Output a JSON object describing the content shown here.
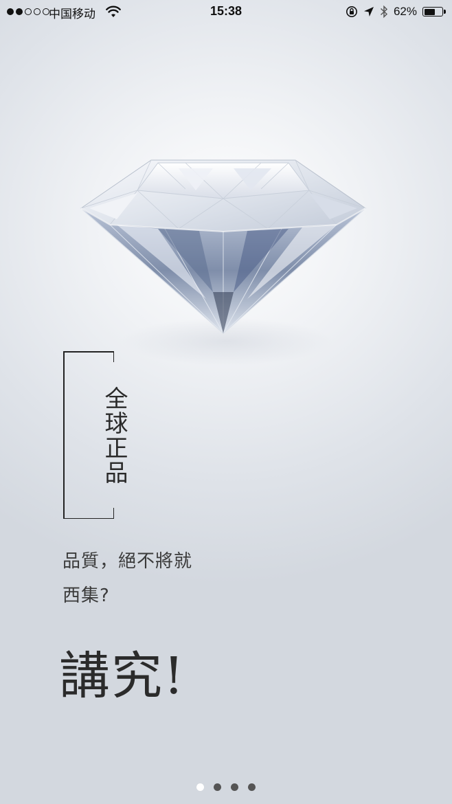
{
  "status_bar": {
    "carrier": "中国移动",
    "time": "15:38",
    "battery_percent": "62%",
    "battery_level": 0.62,
    "signal_bars_filled": 2,
    "signal_bars_total": 5,
    "icons": [
      "signal-dots-icon",
      "wifi-icon",
      "orientation-lock-icon",
      "location-arrow-icon",
      "bluetooth-icon",
      "battery-icon"
    ]
  },
  "hero": {
    "image": "diamond"
  },
  "feature": {
    "vertical_label": "全球正品",
    "tagline_line1": "品質，絕不將就",
    "tagline_line2": "西集?",
    "headline": "講究!"
  },
  "pager": {
    "total": 4,
    "active_index": 0
  }
}
